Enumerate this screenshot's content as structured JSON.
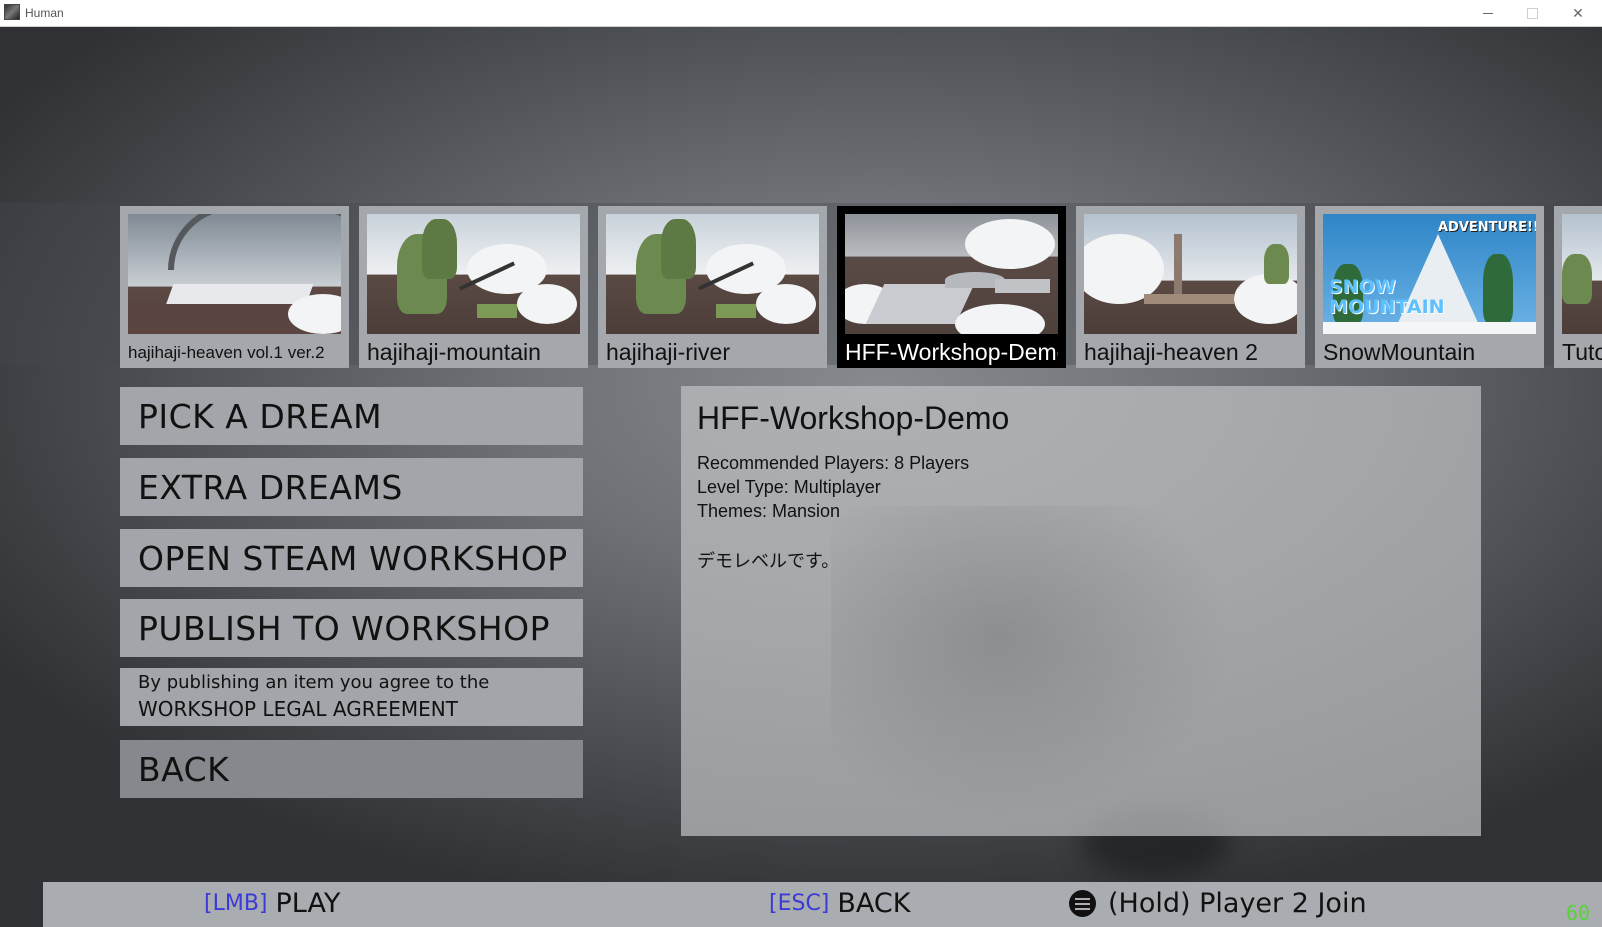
{
  "window": {
    "title": "Human"
  },
  "levels": [
    {
      "name": "hajihaji-heaven vol.1 ver.2",
      "selected": false
    },
    {
      "name": "hajihaji-mountain",
      "selected": false
    },
    {
      "name": "hajihaji-river",
      "selected": false
    },
    {
      "name": "HFF-Workshop-Demo",
      "selected": true
    },
    {
      "name": "hajihaji-heaven 2",
      "selected": false
    },
    {
      "name": "SnowMountain",
      "selected": false,
      "thumb_text": [
        "ADVENTURE!!",
        "SNOW",
        "MOUNTAIN"
      ]
    },
    {
      "name": "Tuto",
      "selected": false
    }
  ],
  "menu": {
    "pick": "PICK A DREAM",
    "extra": "EXTRA DREAMS",
    "open_workshop": "OPEN STEAM WORKSHOP",
    "publish": "PUBLISH TO WORKSHOP",
    "legal_line1": "By publishing an item you agree to the",
    "legal_line2": "WORKSHOP LEGAL AGREEMENT",
    "back": "BACK"
  },
  "detail": {
    "title": "HFF-Workshop-Demo",
    "players": "Recommended Players: 8 Players",
    "level_type": "Level Type: Multiplayer",
    "themes": "Themes: Mansion",
    "description": "デモレベルです。"
  },
  "bottom": {
    "play_key": "[LMB]",
    "play_label": "PLAY",
    "back_key": "[ESC]",
    "back_label": "BACK",
    "join_label": "(Hold) Player 2 Join",
    "join_icon": "menu-icon"
  },
  "fps": "60",
  "colors": {
    "accent_key": "#3a3ad6",
    "fps": "#5bd13a",
    "selected_card": "#000000"
  }
}
